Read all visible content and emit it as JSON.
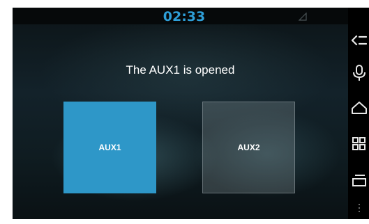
{
  "status_bar": {
    "time": "02:33"
  },
  "main": {
    "message": "The AUX1 is opened",
    "tiles": [
      {
        "label": "AUX1",
        "state": "selected"
      },
      {
        "label": "AUX2",
        "state": "unselected"
      }
    ]
  },
  "nav_bar": {
    "icons": [
      "back-icon",
      "microphone-icon",
      "home-icon",
      "recent-apps-icon",
      "menu-icon",
      "more-icon"
    ]
  },
  "colors": {
    "accent": "#2e97c8",
    "clock": "#2e9fd8"
  }
}
